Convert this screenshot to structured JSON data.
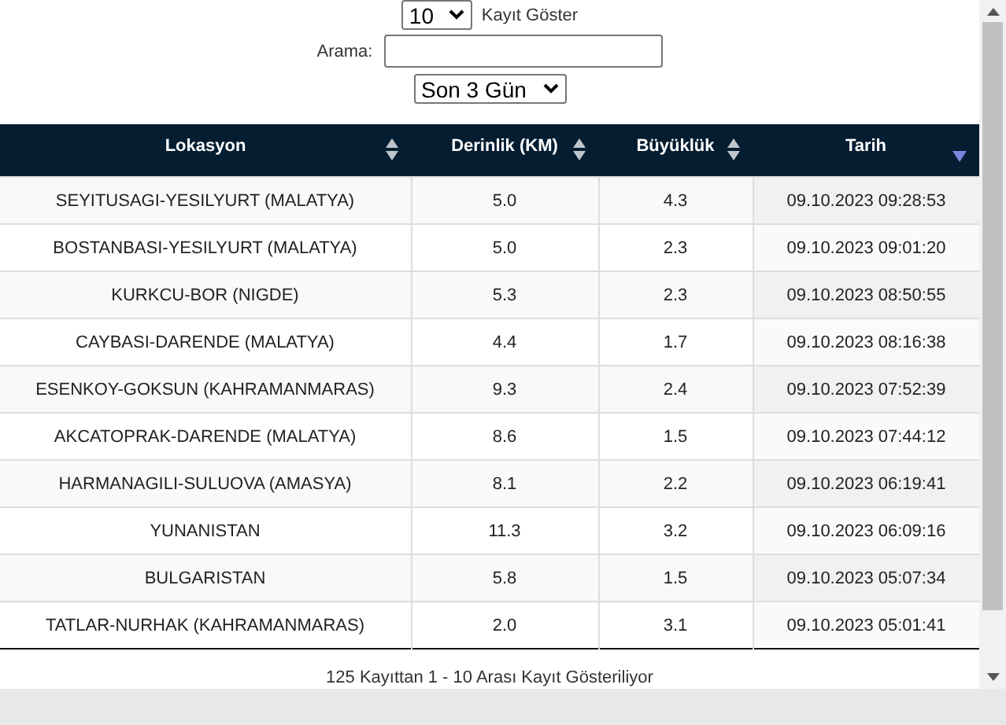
{
  "length_select": {
    "value": "10",
    "label": "Kayıt Göster"
  },
  "search": {
    "label": "Arama:"
  },
  "period_select": {
    "value": "Son 3 Gün"
  },
  "table": {
    "columns": [
      {
        "label": "Lokasyon",
        "sorted": false
      },
      {
        "label": "Derinlik (KM)",
        "sorted": false
      },
      {
        "label": "Büyüklük",
        "sorted": false
      },
      {
        "label": "Tarih",
        "sorted": true
      }
    ],
    "rows": [
      [
        "SEYITUSAGI-YESILYURT (MALATYA)",
        "5.0",
        "4.3",
        "09.10.2023 09:28:53"
      ],
      [
        "BOSTANBASI-YESILYURT (MALATYA)",
        "5.0",
        "2.3",
        "09.10.2023 09:01:20"
      ],
      [
        "KURKCU-BOR (NIGDE)",
        "5.3",
        "2.3",
        "09.10.2023 08:50:55"
      ],
      [
        "CAYBASI-DARENDE (MALATYA)",
        "4.4",
        "1.7",
        "09.10.2023 08:16:38"
      ],
      [
        "ESENKOY-GOKSUN (KAHRAMANMARAS)",
        "9.3",
        "2.4",
        "09.10.2023 07:52:39"
      ],
      [
        "AKCATOPRAK-DARENDE (MALATYA)",
        "8.6",
        "1.5",
        "09.10.2023 07:44:12"
      ],
      [
        "HARMANAGILI-SULUOVA (AMASYA)",
        "8.1",
        "2.2",
        "09.10.2023 06:19:41"
      ],
      [
        "YUNANISTAN",
        "11.3",
        "3.2",
        "09.10.2023 06:09:16"
      ],
      [
        "BULGARISTAN",
        "5.8",
        "1.5",
        "09.10.2023 05:07:34"
      ],
      [
        "TATLAR-NURHAK (KAHRAMANMARAS)",
        "2.0",
        "3.1",
        "09.10.2023 05:01:41"
      ]
    ]
  },
  "info": "125 Kayıttan 1 - 10 Arası Kayıt Gösteriliyor"
}
